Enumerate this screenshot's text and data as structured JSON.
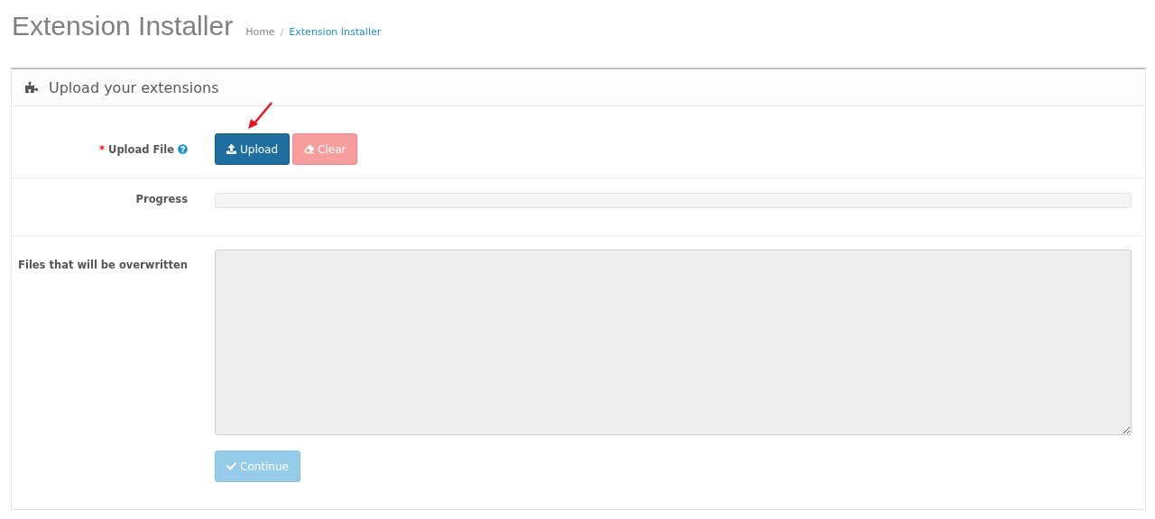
{
  "page": {
    "title": "Extension Installer",
    "breadcrumb_separator": "/",
    "breadcrumb": [
      {
        "label": "Home",
        "selected": false
      },
      {
        "label": "Extension Installer",
        "selected": true
      }
    ]
  },
  "panel": {
    "heading": "Upload your extensions"
  },
  "form": {
    "upload_file": {
      "label": "Upload File",
      "required_mark": "*",
      "buttons": [
        {
          "label": "Upload",
          "kind": "primary",
          "disabled": false
        },
        {
          "label": "Clear",
          "kind": "danger",
          "disabled": true
        }
      ]
    },
    "progress": {
      "label": "Progress",
      "level": 0
    },
    "overwritten": {
      "label": "Files that will be overwritten",
      "disabled": true
    },
    "continue": {
      "label": "Continue",
      "disabled": true
    }
  }
}
